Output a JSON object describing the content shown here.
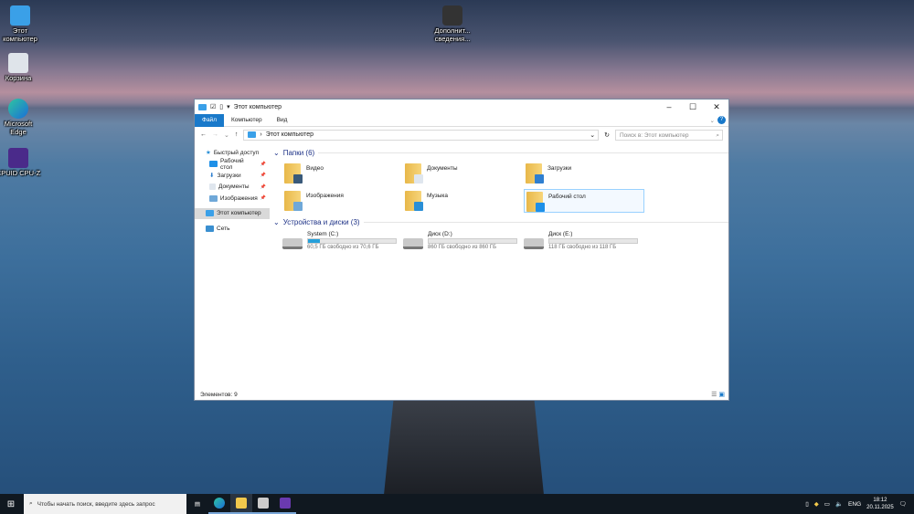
{
  "desktop": {
    "icons": [
      {
        "label": "Этот компьютер"
      },
      {
        "label": "Корзина"
      },
      {
        "label": "Microsoft Edge"
      },
      {
        "label": "CPUID CPU-Z"
      },
      {
        "label": "Дополнит... сведения..."
      }
    ]
  },
  "window": {
    "title": "Этот компьютер",
    "ribbon_tabs": [
      "Файл",
      "Компьютер",
      "Вид"
    ],
    "address": "Этот компьютер",
    "search_placeholder": "Поиск в: Этот компьютер",
    "nav": {
      "quick_access": "Быстрый доступ",
      "quick_items": [
        "Рабочий стол",
        "Загрузки",
        "Документы",
        "Изображения"
      ],
      "this_pc": "Этот компьютер",
      "network": "Сеть"
    },
    "folders_header": "Папки (6)",
    "folders": [
      {
        "name": "Видео",
        "color": "#3a5a7a"
      },
      {
        "name": "Документы",
        "color": "#dfe6ee"
      },
      {
        "name": "Загрузки",
        "color": "#2f7fd0"
      },
      {
        "name": "Изображения",
        "color": "#6fa8d8"
      },
      {
        "name": "Музыка",
        "color": "#2a8fd6"
      },
      {
        "name": "Рабочий стол",
        "color": "#1e90e8"
      }
    ],
    "drives_header": "Устройства и диски (3)",
    "drives": [
      {
        "name": "System (C:)",
        "free": "60,5 ГБ свободно из 70,6 ГБ",
        "used_pct": 14
      },
      {
        "name": "Диск (D:)",
        "free": "860 ГБ свободно из 860 ГБ",
        "used_pct": 0
      },
      {
        "name": "Диск (E:)",
        "free": "118 ГБ свободно из 118 ГБ",
        "used_pct": 0
      }
    ],
    "status": "Элементов: 9"
  },
  "taskbar": {
    "search_placeholder": "Чтобы начать поиск, введите здесь запрос",
    "lang": "ENG",
    "time": "18:12",
    "date": "20.11.2025"
  }
}
